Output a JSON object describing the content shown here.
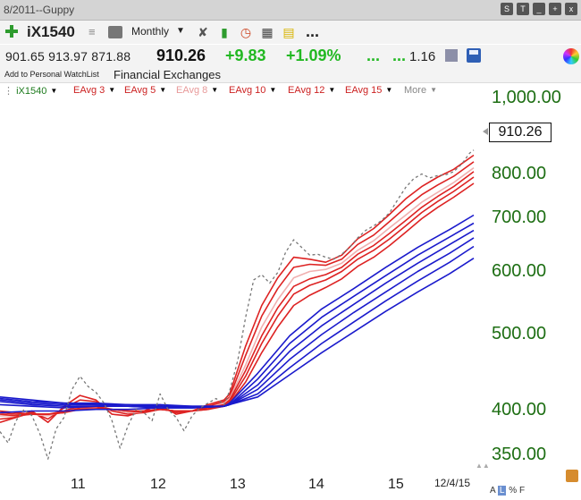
{
  "window": {
    "title": "8/2011--Guppy"
  },
  "toolbar": {
    "symbol": "iX1540",
    "period": "Monthly",
    "more": "..."
  },
  "quote": {
    "ohl": "901.65 913.97 871.88",
    "last": "910.26",
    "change": "+9.83",
    "change_pct": "+1.09%",
    "dots_a": "...",
    "dots_b": "...",
    "ratio": "1.16"
  },
  "subbar": {
    "watchlist": "Add to Personal WatchList",
    "exchange": "Financial Exchanges"
  },
  "legend": [
    {
      "label": "iX1540",
      "color": "#1c7a1c"
    },
    {
      "label": "EAvg 3",
      "color": "#cc2222"
    },
    {
      "label": "EAvg 5",
      "color": "#cc2222"
    },
    {
      "label": "EAvg 8",
      "color": "#e89a9a"
    },
    {
      "label": "EAvg 10",
      "color": "#cc2222"
    },
    {
      "label": "EAvg 12",
      "color": "#cc2222"
    },
    {
      "label": "EAvg 15",
      "color": "#cc2222"
    },
    {
      "label": "More",
      "color": "#888888"
    }
  ],
  "colors": {
    "price": "#777777",
    "short_avg": "#dd2222",
    "short_avg_light": "#f0b0b0",
    "long_avg": "#1a1acc",
    "axis_text": "#1d6e13"
  },
  "chart_data": {
    "type": "line",
    "y_scale": "log",
    "ylim": [
      340,
      1060
    ],
    "yticks": [
      350,
      400,
      500,
      600,
      700,
      800,
      1000
    ],
    "ytick_labels": [
      "350.00",
      "400.00",
      "500.00",
      "600.00",
      "700.00",
      "800.00",
      "1,000.00"
    ],
    "xlim": [
      10.08,
      16.0
    ],
    "xticks": [
      11,
      12,
      13,
      14,
      15
    ],
    "xtick_labels": [
      "11",
      "12",
      "13",
      "14",
      "15"
    ],
    "last_date_label": "12/4/15",
    "last_value_label": "910.26",
    "grid": false,
    "series": [
      {
        "name": "iX1540",
        "style": "dashed",
        "color": "#777777",
        "x": [
          10.08,
          10.18,
          10.28,
          10.38,
          10.48,
          10.58,
          10.68,
          10.78,
          10.88,
          10.98,
          11.08,
          11.18,
          11.28,
          11.38,
          11.48,
          11.58,
          11.68,
          11.78,
          11.88,
          11.98,
          12.08,
          12.18,
          12.28,
          12.38,
          12.48,
          12.58,
          12.68,
          12.78,
          12.88,
          12.95,
          13.05,
          13.15,
          13.25,
          13.35,
          13.45,
          13.55,
          13.65,
          13.75,
          13.85,
          13.95,
          14.05,
          14.15,
          14.25,
          14.35,
          14.45,
          14.55,
          14.65,
          14.75,
          14.85,
          14.95,
          15.05,
          15.15,
          15.25,
          15.35,
          15.45,
          15.55,
          15.65,
          15.75,
          15.85,
          15.95,
          16.0
        ],
        "y": [
          385,
          372,
          398,
          412,
          404,
          382,
          354,
          388,
          402,
          438,
          456,
          442,
          434,
          420,
          398,
          366,
          392,
          412,
          408,
          398,
          432,
          412,
          402,
          386,
          404,
          414,
          420,
          426,
          418,
          436,
          478,
          546,
          612,
          622,
          606,
          626,
          666,
          692,
          676,
          660,
          662,
          656,
          652,
          662,
          676,
          696,
          712,
          722,
          734,
          752,
          782,
          812,
          834,
          846,
          836,
          842,
          844,
          852,
          872,
          902,
          910
        ]
      },
      {
        "name": "EAvg 3",
        "color": "#dd2222",
        "x": [
          10.08,
          10.28,
          10.48,
          10.68,
          10.88,
          11.08,
          11.28,
          11.48,
          11.68,
          11.88,
          12.08,
          12.28,
          12.48,
          12.68,
          12.88,
          12.95,
          13.15,
          13.35,
          13.55,
          13.75,
          13.95,
          14.15,
          14.35,
          14.55,
          14.75,
          14.95,
          15.15,
          15.35,
          15.55,
          15.75,
          16.0
        ],
        "y": [
          396,
          402,
          410,
          396,
          416,
          430,
          424,
          406,
          404,
          410,
          418,
          406,
          410,
          418,
          424,
          432,
          500,
          566,
          616,
          656,
          652,
          646,
          660,
          694,
          716,
          748,
          784,
          814,
          838,
          858,
          896
        ]
      },
      {
        "name": "EAvg 5",
        "color": "#dd2222",
        "x": [
          10.08,
          10.28,
          10.48,
          10.68,
          10.88,
          11.08,
          11.28,
          11.48,
          11.68,
          11.88,
          12.08,
          12.28,
          12.48,
          12.68,
          12.88,
          12.95,
          13.15,
          13.35,
          13.55,
          13.75,
          13.95,
          14.15,
          14.35,
          14.55,
          14.75,
          14.95,
          15.15,
          15.35,
          15.55,
          15.75,
          16.0
        ],
        "y": [
          400,
          402,
          408,
          400,
          414,
          424,
          422,
          410,
          406,
          408,
          414,
          408,
          410,
          416,
          422,
          428,
          486,
          548,
          596,
          636,
          642,
          640,
          652,
          682,
          702,
          732,
          764,
          794,
          818,
          840,
          878
        ]
      },
      {
        "name": "EAvg 8",
        "color": "#f0b0b0",
        "x": [
          10.08,
          10.28,
          10.48,
          10.68,
          10.88,
          11.08,
          11.28,
          11.48,
          11.68,
          11.88,
          12.08,
          12.28,
          12.48,
          12.68,
          12.88,
          12.95,
          13.15,
          13.35,
          13.55,
          13.75,
          13.95,
          14.15,
          14.35,
          14.55,
          14.75,
          14.95,
          15.15,
          15.35,
          15.55,
          15.75,
          16.0
        ],
        "y": [
          404,
          404,
          406,
          404,
          410,
          418,
          418,
          412,
          408,
          408,
          412,
          410,
          410,
          414,
          420,
          426,
          472,
          530,
          576,
          616,
          628,
          632,
          644,
          670,
          690,
          718,
          746,
          776,
          800,
          824,
          862
        ]
      },
      {
        "name": "EAvg 10",
        "color": "#dd2222",
        "x": [
          10.08,
          10.28,
          10.48,
          10.68,
          10.88,
          11.08,
          11.28,
          11.48,
          11.68,
          11.88,
          12.08,
          12.28,
          12.48,
          12.68,
          12.88,
          12.95,
          13.15,
          13.35,
          13.55,
          13.75,
          13.95,
          14.15,
          14.35,
          14.55,
          14.75,
          14.95,
          15.15,
          15.35,
          15.55,
          15.75,
          16.0
        ],
        "y": [
          406,
          404,
          406,
          406,
          410,
          416,
          416,
          412,
          410,
          408,
          412,
          410,
          410,
          414,
          418,
          424,
          464,
          516,
          562,
          600,
          614,
          622,
          636,
          662,
          680,
          706,
          734,
          764,
          790,
          814,
          852
        ]
      },
      {
        "name": "EAvg 12",
        "color": "#dd2222",
        "x": [
          10.08,
          10.28,
          10.48,
          10.68,
          10.88,
          11.08,
          11.28,
          11.48,
          11.68,
          11.88,
          12.08,
          12.28,
          12.48,
          12.68,
          12.88,
          12.95,
          13.15,
          13.35,
          13.55,
          13.75,
          13.95,
          14.15,
          14.35,
          14.55,
          14.75,
          14.95,
          15.15,
          15.35,
          15.55,
          15.75,
          16.0
        ],
        "y": [
          408,
          406,
          406,
          406,
          408,
          414,
          414,
          412,
          410,
          410,
          412,
          410,
          410,
          412,
          418,
          422,
          456,
          504,
          548,
          586,
          602,
          612,
          628,
          652,
          670,
          694,
          722,
          752,
          778,
          802,
          838
        ]
      },
      {
        "name": "EAvg 15",
        "color": "#dd2222",
        "x": [
          10.08,
          10.28,
          10.48,
          10.68,
          10.88,
          11.08,
          11.28,
          11.48,
          11.68,
          11.88,
          12.08,
          12.28,
          12.48,
          12.68,
          12.88,
          12.95,
          13.15,
          13.35,
          13.55,
          13.75,
          13.95,
          14.15,
          14.35,
          14.55,
          14.75,
          14.95,
          15.15,
          15.35,
          15.55,
          15.75,
          16.0
        ],
        "y": [
          410,
          408,
          406,
          406,
          408,
          412,
          412,
          412,
          410,
          410,
          412,
          410,
          410,
          412,
          416,
          420,
          448,
          490,
          530,
          566,
          584,
          598,
          614,
          638,
          656,
          680,
          708,
          738,
          764,
          788,
          822
        ]
      },
      {
        "name": "",
        "color": "#1a1acc",
        "x": [
          10.08,
          10.48,
          10.88,
          11.28,
          11.68,
          12.08,
          12.48,
          12.88,
          12.95,
          13.3,
          13.7,
          14.1,
          14.5,
          14.9,
          15.3,
          15.7,
          16.0
        ],
        "y": [
          418,
          416,
          414,
          416,
          416,
          414,
          414,
          416,
          420,
          460,
          516,
          560,
          596,
          636,
          676,
          714,
          746
        ]
      },
      {
        "name": "",
        "color": "#1a1acc",
        "x": [
          10.08,
          10.48,
          10.88,
          11.28,
          11.68,
          12.08,
          12.48,
          12.88,
          12.95,
          13.3,
          13.7,
          14.1,
          14.5,
          14.9,
          15.3,
          15.7,
          16.0
        ],
        "y": [
          422,
          418,
          416,
          416,
          416,
          414,
          414,
          416,
          418,
          452,
          504,
          546,
          582,
          620,
          660,
          698,
          728
        ]
      },
      {
        "name": "",
        "color": "#1a1acc",
        "x": [
          10.08,
          10.48,
          10.88,
          11.28,
          11.68,
          12.08,
          12.48,
          12.88,
          12.95,
          13.3,
          13.7,
          14.1,
          14.5,
          14.9,
          15.3,
          15.7,
          16.0
        ],
        "y": [
          424,
          420,
          418,
          418,
          416,
          416,
          414,
          416,
          418,
          444,
          492,
          532,
          568,
          606,
          644,
          682,
          712
        ]
      },
      {
        "name": "",
        "color": "#1a1acc",
        "x": [
          10.08,
          10.48,
          10.88,
          11.28,
          11.68,
          12.08,
          12.48,
          12.88,
          12.95,
          13.3,
          13.7,
          14.1,
          14.5,
          14.9,
          15.3,
          15.7,
          16.0
        ],
        "y": [
          426,
          422,
          420,
          418,
          418,
          416,
          416,
          416,
          418,
          438,
          480,
          518,
          554,
          590,
          628,
          664,
          696
        ]
      },
      {
        "name": "",
        "color": "#1a1acc",
        "x": [
          10.08,
          10.48,
          10.88,
          11.28,
          11.68,
          12.08,
          12.48,
          12.88,
          12.95,
          13.3,
          13.7,
          14.1,
          14.5,
          14.9,
          15.3,
          15.7,
          16.0
        ],
        "y": [
          428,
          424,
          420,
          420,
          418,
          418,
          416,
          416,
          418,
          432,
          468,
          504,
          538,
          574,
          610,
          646,
          678
        ]
      },
      {
        "name": "",
        "color": "#1a1acc",
        "x": [
          10.08,
          10.48,
          10.88,
          11.28,
          11.68,
          12.08,
          12.48,
          12.88,
          12.95,
          13.3,
          13.7,
          14.1,
          14.5,
          14.9,
          15.3,
          15.7,
          16.0
        ],
        "y": [
          408,
          410,
          410,
          412,
          412,
          414,
          414,
          416,
          418,
          428,
          458,
          490,
          522,
          556,
          590,
          624,
          654
        ]
      }
    ]
  },
  "scale_options": [
    "A",
    "L",
    "%",
    "F"
  ],
  "scale_selected": "L"
}
